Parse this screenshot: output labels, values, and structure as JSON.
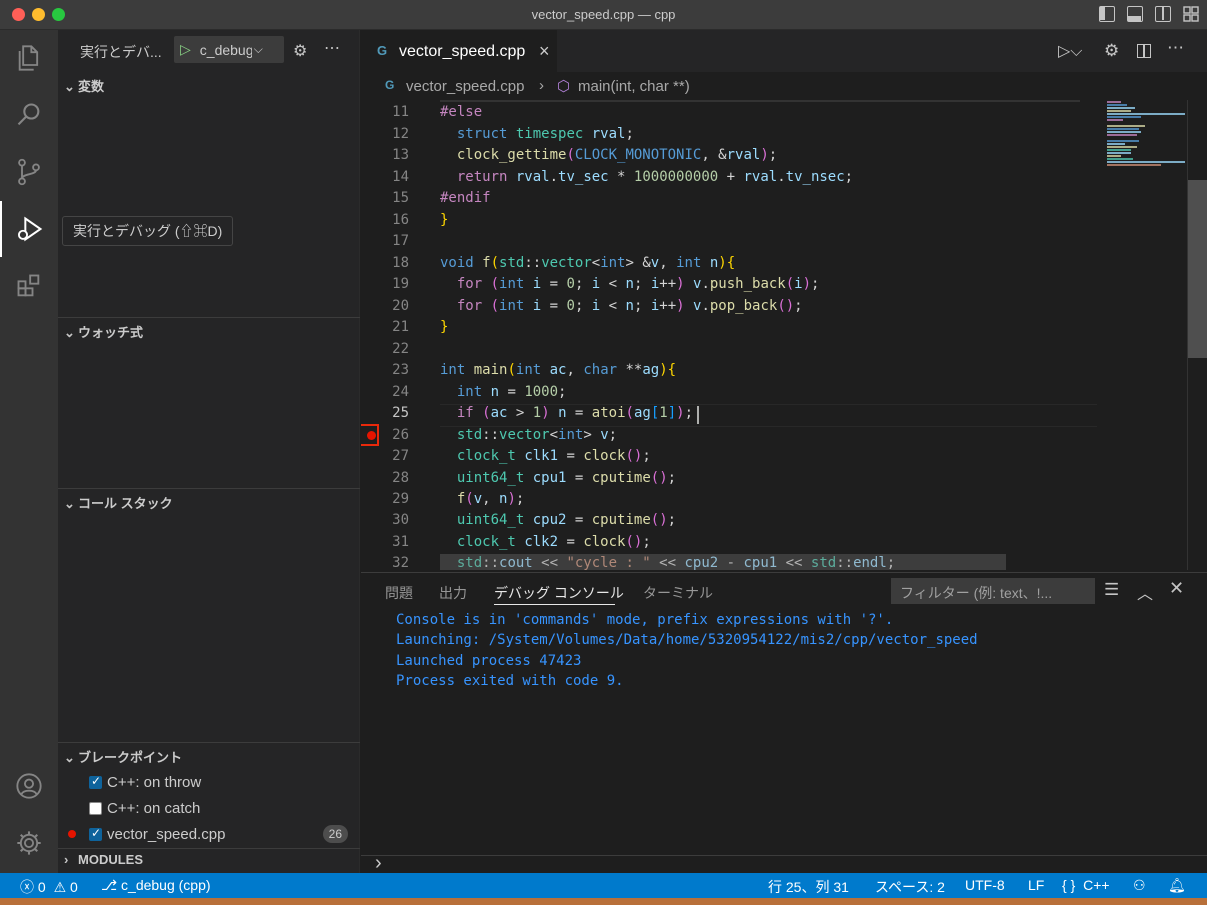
{
  "window": {
    "title": "vector_speed.cpp — cpp"
  },
  "sidebar": {
    "run_label": "実行とデバ...",
    "config_select": "c_debug",
    "sections": {
      "variables": "変数",
      "watch": "ウォッチ式",
      "callstack": "コール スタック",
      "breakpoints": "ブレークポイント",
      "modules": "MODULES"
    },
    "breakpoints": [
      {
        "label": "C++: on throw",
        "checked": true
      },
      {
        "label": "C++: on catch",
        "checked": false
      },
      {
        "label": "vector_speed.cpp",
        "checked": true,
        "line": "26"
      }
    ]
  },
  "tooltip": {
    "text": "実行とデバッグ (⇧⌘D)"
  },
  "editor": {
    "tab": {
      "label": "vector_speed.cpp",
      "close": "×"
    },
    "breadcrumb": {
      "file": "vector_speed.cpp",
      "symbol": "main(int, char **)"
    },
    "line_numbers": [
      "11",
      "12",
      "13",
      "14",
      "15",
      "16",
      "17",
      "18",
      "19",
      "20",
      "21",
      "22",
      "23",
      "24",
      "25",
      "26",
      "27",
      "28",
      "29",
      "30",
      "31",
      "32"
    ],
    "current_line": "25",
    "breakpoint_line": "26"
  },
  "panel": {
    "tabs": [
      "問題",
      "出力",
      "デバッグ コンソール",
      "ターミナル"
    ],
    "active_tab": "デバッグ コンソール",
    "filter_placeholder": "フィルター (例: text、!...",
    "console_lines": [
      "Console is in 'commands' mode, prefix expressions with '?'.",
      "Launching: /System/Volumes/Data/home/5320954122/mis2/cpp/vector_speed",
      "Launched process 47423",
      "Process exited with code 9."
    ],
    "prompt": "›"
  },
  "statusbar": {
    "errors": "0",
    "warnings": "0",
    "debug_config": "c_debug (cpp)",
    "position": "行 25、列 31",
    "spaces": "スペース: 2",
    "encoding": "UTF-8",
    "eol": "LF",
    "language": "C++",
    "lang_braces": "{ }"
  },
  "colors": {
    "accent": "#007acc",
    "breakpoint": "#e51400",
    "highlight_box": "#e8290b"
  }
}
